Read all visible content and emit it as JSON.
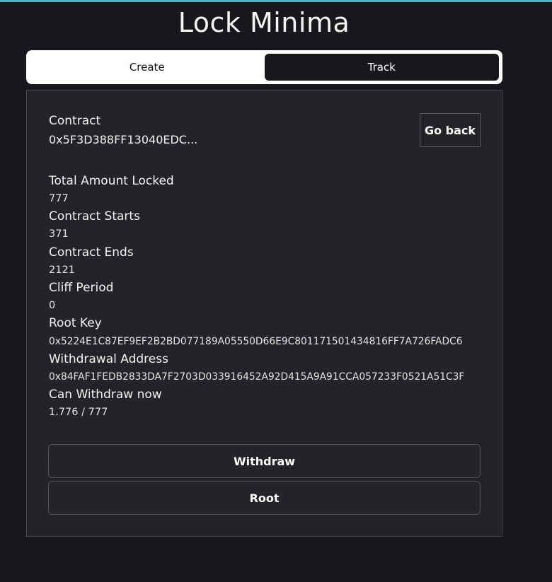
{
  "app": {
    "title": "Lock Minima"
  },
  "tabs": [
    {
      "label": "Create",
      "active": false
    },
    {
      "label": "Track",
      "active": true
    }
  ],
  "contract": {
    "label": "Contract",
    "id": "0x5F3D388FF13040EDC..."
  },
  "go_back_label": "Go back",
  "fields": [
    {
      "label": "Total Amount Locked",
      "value": "777"
    },
    {
      "label": "Contract Starts",
      "value": "371"
    },
    {
      "label": "Contract Ends",
      "value": "2121"
    },
    {
      "label": "Cliff Period",
      "value": "0"
    },
    {
      "label": "Root Key",
      "value": "0x5224E1C87EF9EF2B2BD077189A05550D66E9C801171501434816FF7A726FADC6"
    },
    {
      "label": "Withdrawal Address",
      "value": "0x84FAF1FEDB2833DA7F2703D033916452A92D415A9A91CCA057233F0521A51C3F"
    },
    {
      "label": "Can Withdraw now",
      "value": "1.776 / 777"
    }
  ],
  "actions": {
    "withdraw_label": "Withdraw",
    "root_label": "Root"
  },
  "colors": {
    "background": "#17181c",
    "panel": "#232428",
    "accent_line": "#4fb3c5"
  }
}
